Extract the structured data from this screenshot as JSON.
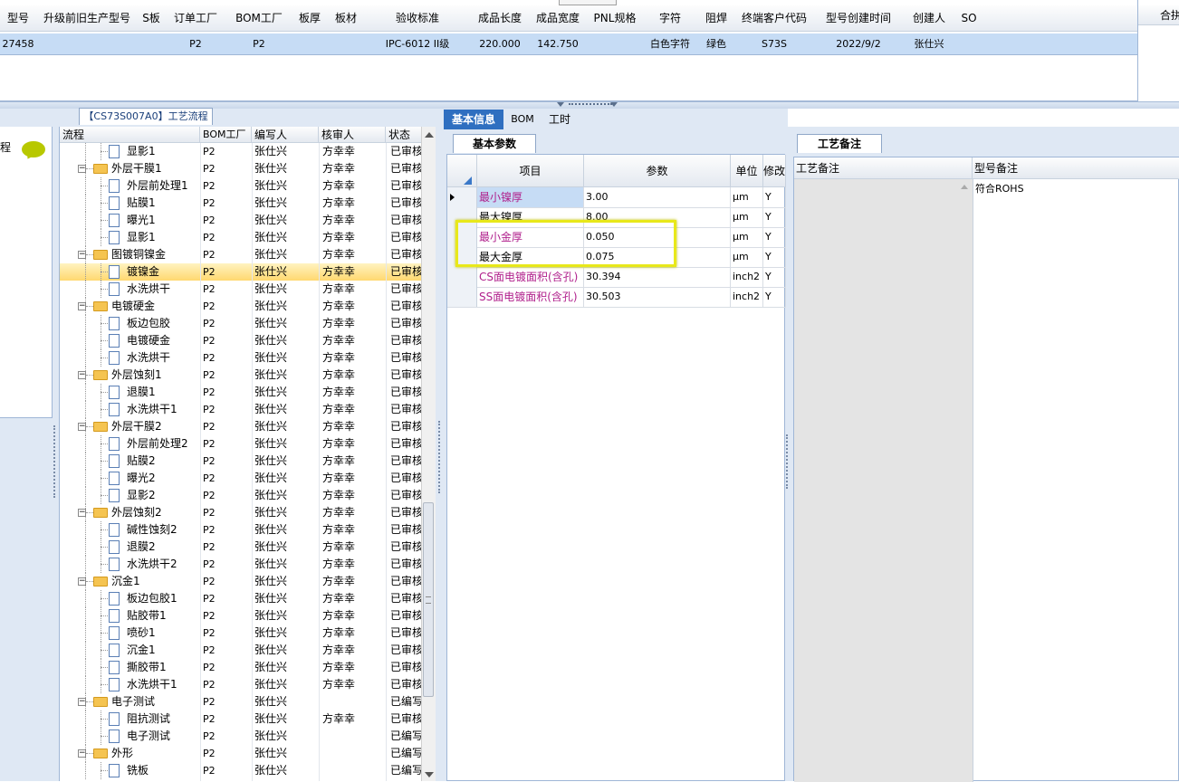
{
  "top_grid": {
    "headers": [
      "型号",
      "升级前旧生产型号",
      "S板",
      "订单工厂",
      "BOM工厂",
      "板厚",
      "板材",
      "验收标准",
      "成品长度",
      "成品宽度",
      "PNL规格",
      "字符",
      "阻焊",
      "终端客户代码",
      "型号创建时间",
      "创建人",
      "SO"
    ],
    "row": [
      "27458",
      "",
      "",
      "P2",
      "P2",
      "",
      "",
      "IPC-6012 II级",
      "220.000",
      "142.750",
      "",
      "白色字符",
      "绿色",
      "S73S",
      "2022/9/2",
      "张仕兴",
      ""
    ],
    "right_header": "合拼"
  },
  "left_panel": {
    "tab_label": "【CS73S007A0】工艺流程",
    "columns": [
      "流程",
      "BOM工厂",
      "编写人",
      "核审人",
      "状态"
    ],
    "rows": [
      {
        "name": "显影1",
        "level": 2,
        "kind": "doc",
        "bom": "P2",
        "writer": "张仕兴",
        "reviewer": "方幸幸",
        "status": "已审核"
      },
      {
        "name": "外层干膜1",
        "level": 1,
        "kind": "folder",
        "bom": "P2",
        "writer": "张仕兴",
        "reviewer": "方幸幸",
        "status": "已审核"
      },
      {
        "name": "外层前处理1",
        "level": 2,
        "kind": "doc",
        "bom": "P2",
        "writer": "张仕兴",
        "reviewer": "方幸幸",
        "status": "已审核"
      },
      {
        "name": "贴膜1",
        "level": 2,
        "kind": "doc",
        "bom": "P2",
        "writer": "张仕兴",
        "reviewer": "方幸幸",
        "status": "已审核"
      },
      {
        "name": "曝光1",
        "level": 2,
        "kind": "doc",
        "bom": "P2",
        "writer": "张仕兴",
        "reviewer": "方幸幸",
        "status": "已审核"
      },
      {
        "name": "显影1",
        "level": 2,
        "kind": "doc",
        "bom": "P2",
        "writer": "张仕兴",
        "reviewer": "方幸幸",
        "status": "已审核"
      },
      {
        "name": "图镀铜镍金",
        "level": 1,
        "kind": "folder",
        "bom": "P2",
        "writer": "张仕兴",
        "reviewer": "方幸幸",
        "status": "已审核"
      },
      {
        "name": "镀镍金",
        "level": 2,
        "kind": "doc",
        "bom": "P2",
        "writer": "张仕兴",
        "reviewer": "方幸幸",
        "status": "已审核",
        "selected": true
      },
      {
        "name": "水洗烘干",
        "level": 2,
        "kind": "doc",
        "bom": "P2",
        "writer": "张仕兴",
        "reviewer": "方幸幸",
        "status": "已审核"
      },
      {
        "name": "电镀硬金",
        "level": 1,
        "kind": "folder",
        "bom": "P2",
        "writer": "张仕兴",
        "reviewer": "方幸幸",
        "status": "已审核"
      },
      {
        "name": "板边包胶",
        "level": 2,
        "kind": "doc",
        "bom": "P2",
        "writer": "张仕兴",
        "reviewer": "方幸幸",
        "status": "已审核"
      },
      {
        "name": "电镀硬金",
        "level": 2,
        "kind": "doc",
        "bom": "P2",
        "writer": "张仕兴",
        "reviewer": "方幸幸",
        "status": "已审核"
      },
      {
        "name": "水洗烘干",
        "level": 2,
        "kind": "doc",
        "bom": "P2",
        "writer": "张仕兴",
        "reviewer": "方幸幸",
        "status": "已审核"
      },
      {
        "name": "外层蚀刻1",
        "level": 1,
        "kind": "folder",
        "bom": "P2",
        "writer": "张仕兴",
        "reviewer": "方幸幸",
        "status": "已审核"
      },
      {
        "name": "退膜1",
        "level": 2,
        "kind": "doc",
        "bom": "P2",
        "writer": "张仕兴",
        "reviewer": "方幸幸",
        "status": "已审核"
      },
      {
        "name": "水洗烘干1",
        "level": 2,
        "kind": "doc",
        "bom": "P2",
        "writer": "张仕兴",
        "reviewer": "方幸幸",
        "status": "已审核"
      },
      {
        "name": "外层干膜2",
        "level": 1,
        "kind": "folder",
        "bom": "P2",
        "writer": "张仕兴",
        "reviewer": "方幸幸",
        "status": "已审核"
      },
      {
        "name": "外层前处理2",
        "level": 2,
        "kind": "doc",
        "bom": "P2",
        "writer": "张仕兴",
        "reviewer": "方幸幸",
        "status": "已审核"
      },
      {
        "name": "贴膜2",
        "level": 2,
        "kind": "doc",
        "bom": "P2",
        "writer": "张仕兴",
        "reviewer": "方幸幸",
        "status": "已审核"
      },
      {
        "name": "曝光2",
        "level": 2,
        "kind": "doc",
        "bom": "P2",
        "writer": "张仕兴",
        "reviewer": "方幸幸",
        "status": "已审核"
      },
      {
        "name": "显影2",
        "level": 2,
        "kind": "doc",
        "bom": "P2",
        "writer": "张仕兴",
        "reviewer": "方幸幸",
        "status": "已审核"
      },
      {
        "name": "外层蚀刻2",
        "level": 1,
        "kind": "folder",
        "bom": "P2",
        "writer": "张仕兴",
        "reviewer": "方幸幸",
        "status": "已审核"
      },
      {
        "name": "碱性蚀刻2",
        "level": 2,
        "kind": "doc",
        "bom": "P2",
        "writer": "张仕兴",
        "reviewer": "方幸幸",
        "status": "已审核"
      },
      {
        "name": "退膜2",
        "level": 2,
        "kind": "doc",
        "bom": "P2",
        "writer": "张仕兴",
        "reviewer": "方幸幸",
        "status": "已审核"
      },
      {
        "name": "水洗烘干2",
        "level": 2,
        "kind": "doc",
        "bom": "P2",
        "writer": "张仕兴",
        "reviewer": "方幸幸",
        "status": "已审核"
      },
      {
        "name": "沉金1",
        "level": 1,
        "kind": "folder",
        "bom": "P2",
        "writer": "张仕兴",
        "reviewer": "方幸幸",
        "status": "已审核"
      },
      {
        "name": "板边包胶1",
        "level": 2,
        "kind": "doc",
        "bom": "P2",
        "writer": "张仕兴",
        "reviewer": "方幸幸",
        "status": "已审核"
      },
      {
        "name": "贴胶带1",
        "level": 2,
        "kind": "doc",
        "bom": "P2",
        "writer": "张仕兴",
        "reviewer": "方幸幸",
        "status": "已审核"
      },
      {
        "name": "喷砂1",
        "level": 2,
        "kind": "doc",
        "bom": "P2",
        "writer": "张仕兴",
        "reviewer": "方幸幸",
        "status": "已审核"
      },
      {
        "name": "沉金1",
        "level": 2,
        "kind": "doc",
        "bom": "P2",
        "writer": "张仕兴",
        "reviewer": "方幸幸",
        "status": "已审核"
      },
      {
        "name": "撕胶带1",
        "level": 2,
        "kind": "doc",
        "bom": "P2",
        "writer": "张仕兴",
        "reviewer": "方幸幸",
        "status": "已审核"
      },
      {
        "name": "水洗烘干1",
        "level": 2,
        "kind": "doc",
        "bom": "P2",
        "writer": "张仕兴",
        "reviewer": "方幸幸",
        "status": "已审核"
      },
      {
        "name": "电子测试",
        "level": 1,
        "kind": "folder",
        "bom": "P2",
        "writer": "张仕兴",
        "reviewer": "",
        "status": "已编写"
      },
      {
        "name": "阻抗测试",
        "level": 2,
        "kind": "doc",
        "bom": "P2",
        "writer": "张仕兴",
        "reviewer": "方幸幸",
        "status": "已审核"
      },
      {
        "name": "电子测试",
        "level": 2,
        "kind": "doc",
        "bom": "P2",
        "writer": "张仕兴",
        "reviewer": "",
        "status": "已编写"
      },
      {
        "name": "外形",
        "level": 1,
        "kind": "folder",
        "bom": "P2",
        "writer": "张仕兴",
        "reviewer": "",
        "status": "已编写"
      },
      {
        "name": "铣板",
        "level": 2,
        "kind": "doc",
        "bom": "P2",
        "writer": "张仕兴",
        "reviewer": "",
        "status": "已编写"
      }
    ]
  },
  "middle_panel": {
    "tabs": [
      "基本信息",
      "BOM",
      "工时"
    ],
    "sub_tab": "基本参数",
    "columns": [
      "项目",
      "参数",
      "单位",
      "修改"
    ],
    "rows": [
      {
        "item": "最小镍厚",
        "value": "3.00",
        "unit": "μm",
        "mod": "Y",
        "pink": true,
        "current": true
      },
      {
        "item": "最大镍厚",
        "value": "8.00",
        "unit": "μm",
        "mod": "Y",
        "pink": false
      },
      {
        "item": "最小金厚",
        "value": "0.050",
        "unit": "μm",
        "mod": "Y",
        "pink": true
      },
      {
        "item": "最大金厚",
        "value": "0.075",
        "unit": "μm",
        "mod": "Y",
        "pink": false
      },
      {
        "item": "CS面电镀面积(含孔)",
        "value": "30.394",
        "unit": "inch2",
        "mod": "Y",
        "pink": true
      },
      {
        "item": "SS面电镀面积(含孔)",
        "value": "30.503",
        "unit": "inch2",
        "mod": "Y",
        "pink": true
      }
    ],
    "pink_color": "#b0208c",
    "highlight_color": "#e8e81a"
  },
  "right_panel": {
    "tab": "工艺备注",
    "columns": [
      "工艺备注",
      "型号备注"
    ],
    "model_note": "符合ROHS"
  }
}
